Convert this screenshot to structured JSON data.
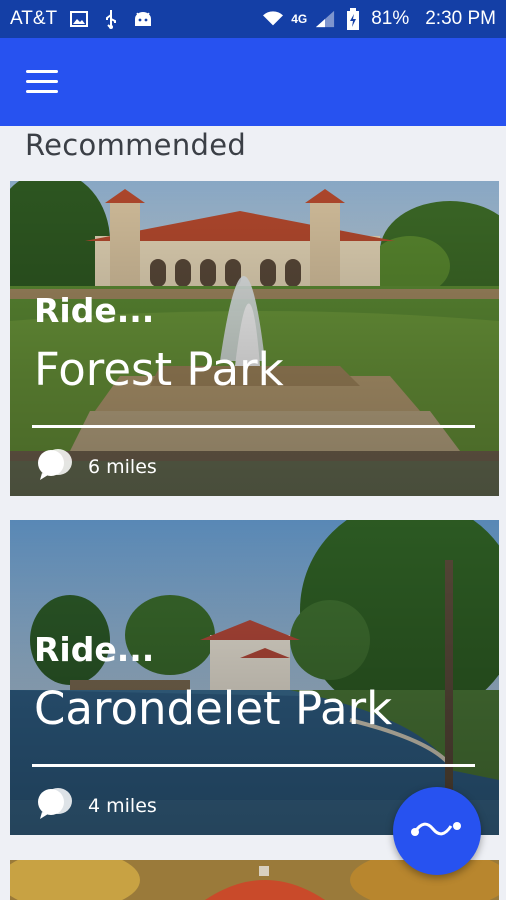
{
  "status_bar": {
    "carrier": "AT&T",
    "network": "4G",
    "battery": "81%",
    "time": "2:30 PM",
    "icons": [
      "image-icon",
      "usb-icon",
      "android-icon",
      "wifi-icon",
      "signal-icon",
      "battery-charging-icon"
    ]
  },
  "app_bar": {
    "menu_icon": "hamburger-menu-icon"
  },
  "section": {
    "title": "Recommended"
  },
  "cards": [
    {
      "prefix": "Ride...",
      "name": "Forest Park",
      "distance": "6 miles",
      "distance_icon": "speech-bubbles-icon"
    },
    {
      "prefix": "Ride...",
      "name": "Carondelet Park",
      "distance": "4 miles",
      "distance_icon": "speech-bubbles-icon"
    }
  ],
  "fab": {
    "icon": "route-wave-icon"
  },
  "colors": {
    "status_bar": "#143fa6",
    "app_bar": "#2752f0",
    "background": "#eef0f5",
    "fab": "#2752f0"
  }
}
